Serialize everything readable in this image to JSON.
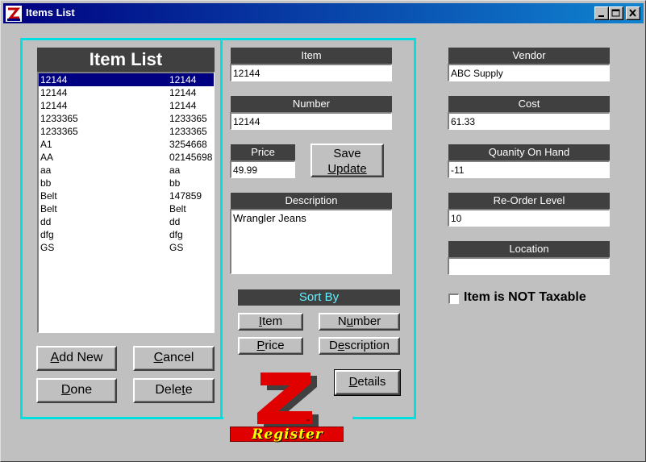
{
  "window": {
    "title": "Items List"
  },
  "item_list": {
    "header": "Item List",
    "rows": [
      {
        "item": "12144",
        "number": "12144",
        "selected": true
      },
      {
        "item": "12144",
        "number": "12144",
        "selected": false
      },
      {
        "item": "12144",
        "number": "12144",
        "selected": false
      },
      {
        "item": "1233365",
        "number": "1233365",
        "selected": false
      },
      {
        "item": "1233365",
        "number": "1233365",
        "selected": false
      },
      {
        "item": "A1",
        "number": "3254668",
        "selected": false
      },
      {
        "item": "AA",
        "number": "02145698",
        "selected": false
      },
      {
        "item": "aa",
        "number": "aa",
        "selected": false
      },
      {
        "item": "bb",
        "number": "bb",
        "selected": false
      },
      {
        "item": "Belt",
        "number": "147859",
        "selected": false
      },
      {
        "item": "Belt",
        "number": "Belt",
        "selected": false
      },
      {
        "item": "dd",
        "number": "dd",
        "selected": false
      },
      {
        "item": "dfg",
        "number": "dfg",
        "selected": false
      },
      {
        "item": "GS",
        "number": "GS",
        "selected": false
      }
    ]
  },
  "buttons": {
    "add_new": {
      "pre": "",
      "key": "A",
      "post": "dd New"
    },
    "cancel": {
      "pre": "",
      "key": "C",
      "post": "ancel"
    },
    "done": {
      "pre": "",
      "key": "D",
      "post": "one"
    },
    "delete": {
      "pre": "Dele",
      "key": "t",
      "post": "e"
    },
    "save_update": {
      "line1": "Save",
      "line2": "Update"
    },
    "details": {
      "pre": "",
      "key": "D",
      "post": "etails"
    }
  },
  "fields": {
    "item": {
      "label": "Item",
      "value": "12144"
    },
    "number": {
      "label": "Number",
      "value": "12144"
    },
    "price": {
      "label": "Price",
      "value": "49.99"
    },
    "description": {
      "label": "Description",
      "value": "Wrangler Jeans"
    },
    "vendor": {
      "label": "Vendor",
      "value": "ABC Supply"
    },
    "cost": {
      "label": "Cost",
      "value": "61.33"
    },
    "quantity": {
      "label": "Quanity On Hand",
      "value": "-11"
    },
    "reorder": {
      "label": "Re-Order Level",
      "value": "10"
    },
    "location": {
      "label": "Location",
      "value": ""
    }
  },
  "sort_by": {
    "header": "Sort By",
    "item": {
      "pre": "",
      "key": "I",
      "post": "tem"
    },
    "number": {
      "pre": "N",
      "key": "u",
      "post": "mber"
    },
    "price": {
      "pre": "",
      "key": "P",
      "post": "rice"
    },
    "description": {
      "pre": "D",
      "key": "e",
      "post": "scription"
    }
  },
  "taxable": {
    "label": "Item is NOT Taxable",
    "checked": false
  },
  "logo": {
    "letter": "Z",
    "text": "Register"
  },
  "colors": {
    "accent_frame": "#00e0e0",
    "label_bg": "#404040",
    "sort_header_text": "#60f0ff",
    "selection": "#000080",
    "logo_red": "#e00000",
    "logo_yellow": "#ffff00"
  }
}
